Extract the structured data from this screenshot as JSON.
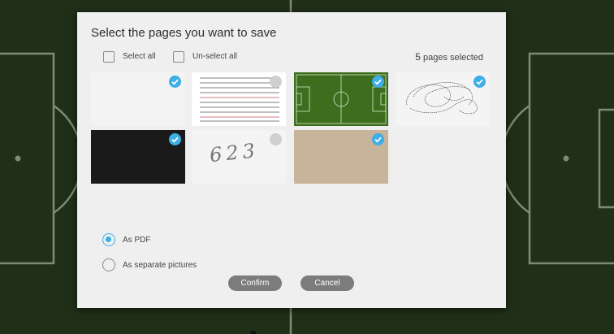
{
  "dialog": {
    "title": "Select the pages you want to save",
    "select_all_label": "Select all",
    "unselect_all_label": "Un-select all",
    "selected_count": "5",
    "selected_suffix": "pages selected"
  },
  "pages": [
    {
      "name": "blank-white",
      "selected": true
    },
    {
      "name": "lined-paper",
      "selected": false
    },
    {
      "name": "soccer-field",
      "selected": true
    },
    {
      "name": "scribble-drawing",
      "selected": true
    },
    {
      "name": "black-page",
      "selected": true
    },
    {
      "name": "handwritten-623",
      "selected": false,
      "text": "623"
    },
    {
      "name": "tan-page",
      "selected": true
    }
  ],
  "format": {
    "options": [
      {
        "label": "As PDF",
        "selected": true
      },
      {
        "label": "As separate pictures",
        "selected": false
      }
    ]
  },
  "buttons": {
    "confirm": "Confirm",
    "cancel": "Cancel"
  },
  "colors": {
    "accent": "#3daee6",
    "button": "#7c7c7c",
    "field_green": "#3d6e1e",
    "tan": "#c8b49b",
    "background": "#203018"
  }
}
